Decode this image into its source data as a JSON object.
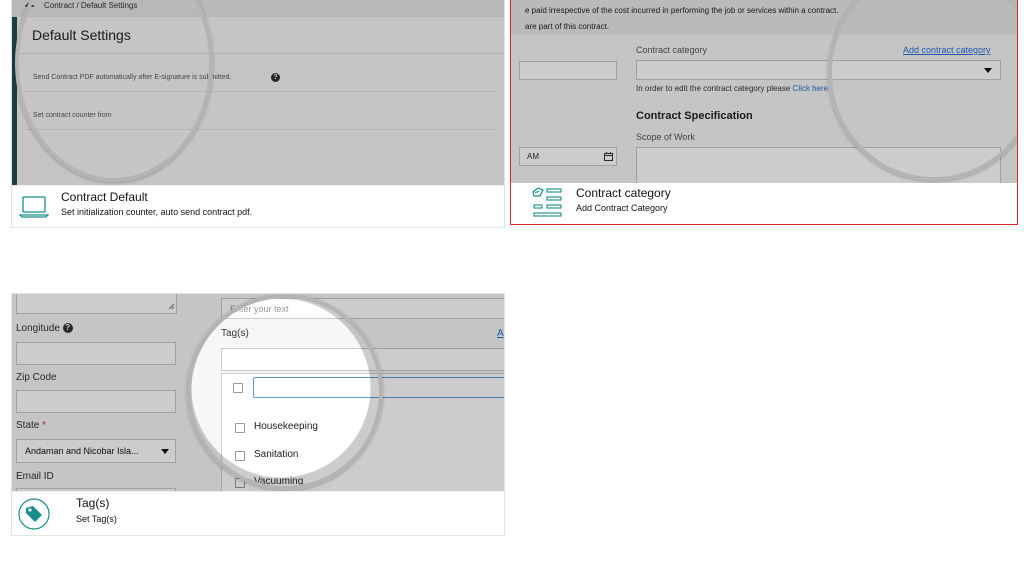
{
  "colors": {
    "selected_border": "#e0242b",
    "teal_icon": "#1a8c8c",
    "link": "#2a6ed9",
    "overlay": "rgba(0,0,0,0.20)"
  },
  "cards": {
    "contract_default": {
      "shot": {
        "breadcrumb": "Contract / Default Settings",
        "back_icon": "arrow-left-icon",
        "heading": "Default Settings",
        "row1": "Send Contract PDF automatically after E-signature is submitted.",
        "help_icon": "question-circle-icon",
        "row2": "Set contract counter from"
      },
      "icon": "laptop-icon",
      "title": "Contract Default",
      "subtitle": "Set initialization counter, auto send contract pdf."
    },
    "contract_category": {
      "shot": {
        "info_line1": "e paid irrespective of the cost incurred in performing the job or services within a contract.",
        "info_line2": "are part of this contract.",
        "field_label": "Contract category",
        "add_link": "Add contract category",
        "hint_text": "In order to edit the contract category please",
        "hint_link": "Click here",
        "section_title": "Contract Specification",
        "scope_label": "Scope of Work",
        "time_fragment": "AM",
        "calendar_icon": "calendar-icon"
      },
      "icon": "list-tag-icon",
      "title": "Contract category",
      "subtitle": "Add Contract Category"
    },
    "tags": {
      "shot": {
        "longitude_label": "Longitude",
        "zip_label": "Zip Code",
        "state_label": "State",
        "required_mark": "*",
        "state_value": "Andaman and Nicobar Isla...",
        "email_label": "Email ID",
        "text_placeholder": "Enter your text",
        "tags_label": "Tag(s)",
        "add_fragment": "A",
        "options": [
          "Housekeeping",
          "Sanitation",
          "Vacuuming"
        ]
      },
      "icon": "tag-icon",
      "title": "Tag(s)",
      "subtitle": "Set Tag(s)"
    }
  }
}
